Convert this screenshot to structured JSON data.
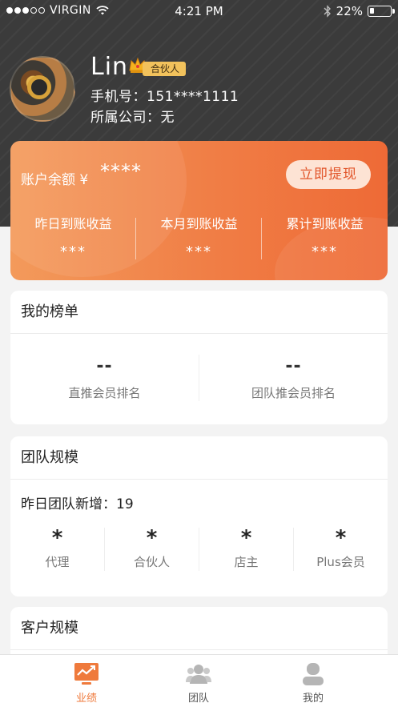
{
  "status_bar": {
    "carrier": "VIRGIN",
    "time": "4:21 PM",
    "battery": "22%",
    "battery_level": 0.22
  },
  "profile": {
    "name": "Lin",
    "badge": "合伙人",
    "phone": "手机号：151****1111",
    "company": "所属公司：无"
  },
  "account": {
    "balance_label": "账户余额 ¥",
    "balance_value": "****",
    "withdraw_label": "立即提现",
    "earnings": [
      {
        "label": "昨日到账收益",
        "value": "***"
      },
      {
        "label": "本月到账收益",
        "value": "***"
      },
      {
        "label": "累计到账收益",
        "value": "***"
      }
    ]
  },
  "ranking": {
    "title": "我的榜单",
    "items": [
      {
        "value": "--",
        "label": "直推会员排名"
      },
      {
        "value": "--",
        "label": "团队推会员排名"
      }
    ]
  },
  "team": {
    "title": "团队规模",
    "new_yesterday": "昨日团队新增：19",
    "items": [
      {
        "value": "*",
        "label": "代理"
      },
      {
        "value": "*",
        "label": "合伙人"
      },
      {
        "value": "*",
        "label": "店主"
      },
      {
        "value": "*",
        "label": "Plus会员"
      }
    ]
  },
  "customer": {
    "title": "客户规模"
  },
  "tabs": [
    {
      "label": "业绩",
      "icon": "performance-icon",
      "active": true
    },
    {
      "label": "团队",
      "icon": "team-icon",
      "active": false
    },
    {
      "label": "我的",
      "icon": "profile-icon",
      "active": false
    }
  ],
  "colors": {
    "accent": "#ef7a3c",
    "header_bg": "#3b3b3b"
  }
}
